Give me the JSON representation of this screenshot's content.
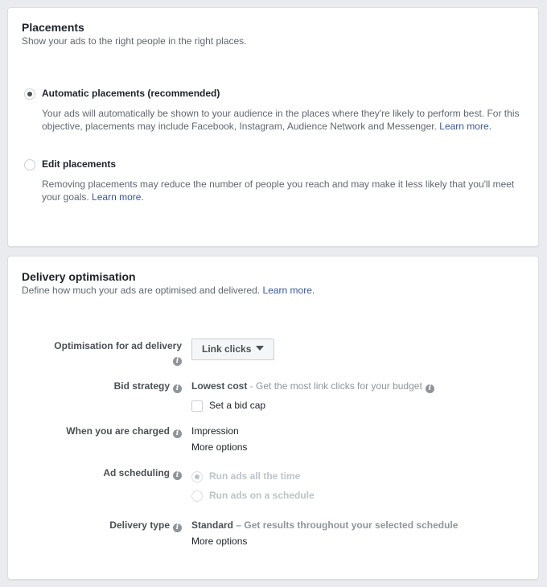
{
  "placements": {
    "title": "Placements",
    "subtitle": "Show your ads to the right people in the right places.",
    "options": [
      {
        "label": "Automatic placements (recommended)",
        "selected": true,
        "description": "Your ads will automatically be shown to your audience in the places where they're likely to perform best. For this objective, placements may include Facebook, Instagram, Audience Network and Messenger.",
        "link": "Learn more."
      },
      {
        "label": "Edit placements",
        "selected": false,
        "description": "Removing placements may reduce the number of people you reach and may make it less likely that you'll meet your goals.",
        "link": "Learn more."
      }
    ]
  },
  "delivery": {
    "title": "Delivery optimisation",
    "subtitle": "Define how much your ads are optimised and delivered.",
    "subtitle_link": "Learn more.",
    "optimisation": {
      "label": "Optimisation for ad delivery",
      "value": "Link clicks",
      "icon": "info-icon"
    },
    "bid_strategy": {
      "label": "Bid strategy",
      "value": "Lowest cost",
      "description": " - Get the most link clicks for your budget",
      "checkbox_label": "Set a bid cap",
      "checkbox_checked": false
    },
    "charged": {
      "label": "When you are charged",
      "value": "Impression",
      "link": "More options"
    },
    "scheduling": {
      "label": "Ad scheduling",
      "options": [
        {
          "label": "Run ads all the time",
          "selected": true,
          "disabled": true
        },
        {
          "label": "Run ads on a schedule",
          "selected": false,
          "disabled": true
        }
      ]
    },
    "delivery_type": {
      "label": "Delivery type",
      "value": "Standard",
      "description": " – Get results throughout your selected schedule",
      "link": "More options"
    }
  }
}
